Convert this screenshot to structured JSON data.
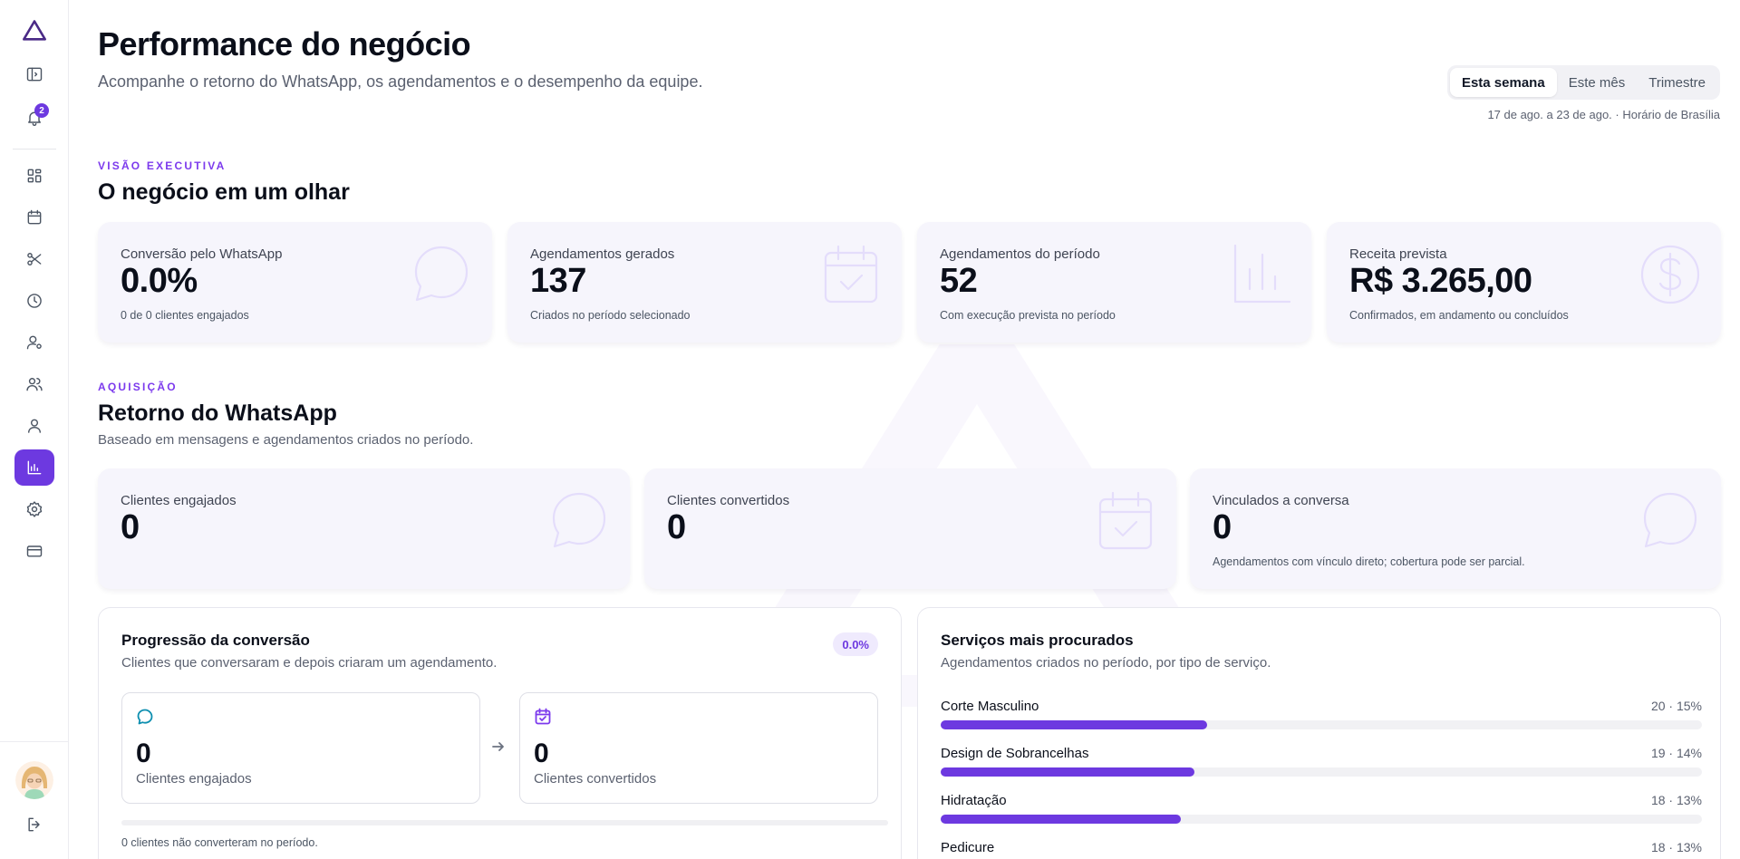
{
  "sidebar": {
    "notification_count": "2",
    "active_item": "reports",
    "items": [
      {
        "name": "toggle-sidebar",
        "icon": "panel-icon"
      },
      {
        "name": "notifications",
        "icon": "bell-icon"
      },
      {
        "name": "dashboard",
        "icon": "grid-icon"
      },
      {
        "name": "calendar",
        "icon": "calendar-icon"
      },
      {
        "name": "services",
        "icon": "scissors-icon"
      },
      {
        "name": "history",
        "icon": "clock-icon"
      },
      {
        "name": "professionals",
        "icon": "user-settings-icon"
      },
      {
        "name": "clients",
        "icon": "users-icon"
      },
      {
        "name": "profile",
        "icon": "user-icon"
      },
      {
        "name": "reports",
        "icon": "bar-chart-icon"
      },
      {
        "name": "settings",
        "icon": "gear-icon"
      },
      {
        "name": "billing",
        "icon": "credit-card-icon"
      },
      {
        "name": "logout",
        "icon": "logout-icon"
      }
    ]
  },
  "header": {
    "title": "Performance do negócio",
    "subtitle": "Acompanhe o retorno do WhatsApp, os agendamentos e o desempenho da equipe."
  },
  "period": {
    "options": [
      "Esta semana",
      "Este mês",
      "Trimestre"
    ],
    "selected": "Esta semana",
    "caption": "17 de ago. a 23 de ago. · Horário de Brasília"
  },
  "executive": {
    "eyebrow": "VISÃO EXECUTIVA",
    "title": "O negócio em um olhar",
    "kpis": [
      {
        "label": "Conversão pelo WhatsApp",
        "value": "0.0%",
        "note": "0 de 0 clientes engajados",
        "icon": "chat-bubble-icon"
      },
      {
        "label": "Agendamentos gerados",
        "value": "137",
        "note": "Criados no período selecionado",
        "icon": "calendar-check-icon"
      },
      {
        "label": "Agendamentos do período",
        "value": "52",
        "note": "Com execução prevista no período",
        "icon": "bar-chart-icon"
      },
      {
        "label": "Receita prevista",
        "value": "R$ 3.265,00",
        "note": "Confirmados, em andamento ou concluídos",
        "icon": "dollar-circle-icon"
      }
    ]
  },
  "acquisition": {
    "eyebrow": "AQUISIÇÃO",
    "title": "Retorno do WhatsApp",
    "description": "Baseado em mensagens e agendamentos criados no período.",
    "kpis": [
      {
        "label": "Clientes engajados",
        "value": "0",
        "note": "",
        "icon": "chat-bubble-icon"
      },
      {
        "label": "Clientes convertidos",
        "value": "0",
        "note": "",
        "icon": "calendar-check-icon"
      },
      {
        "label": "Vinculados a conversa",
        "value": "0",
        "note": "Agendamentos com vínculo direto; cobertura pode ser parcial.",
        "icon": "chat-bubble-icon"
      }
    ]
  },
  "conversion": {
    "title": "Progressão da conversão",
    "description": "Clientes que conversaram e depois criaram um agendamento.",
    "badge": "0.0%",
    "engaged": {
      "value": "0",
      "label": "Clientes engajados"
    },
    "converted": {
      "value": "0",
      "label": "Clientes convertidos"
    },
    "progress_fraction": 0,
    "note": "0 clientes não converteram no período."
  },
  "services": {
    "title": "Serviços mais procurados",
    "description": "Agendamentos criados no período, por tipo de serviço.",
    "items": [
      {
        "name": "Corte Masculino",
        "meta": "20 · 15%",
        "fraction": 0.35
      },
      {
        "name": "Design de Sobrancelhas",
        "meta": "19 · 14%",
        "fraction": 0.333
      },
      {
        "name": "Hidratação",
        "meta": "18 · 13%",
        "fraction": 0.315
      },
      {
        "name": "Pedicure",
        "meta": "18 · 13%",
        "fraction": 0.315
      }
    ]
  },
  "colors": {
    "accent": "#6d39e0",
    "card_bg": "#f6f5fc",
    "icon_faint": "#e4ddfb"
  }
}
